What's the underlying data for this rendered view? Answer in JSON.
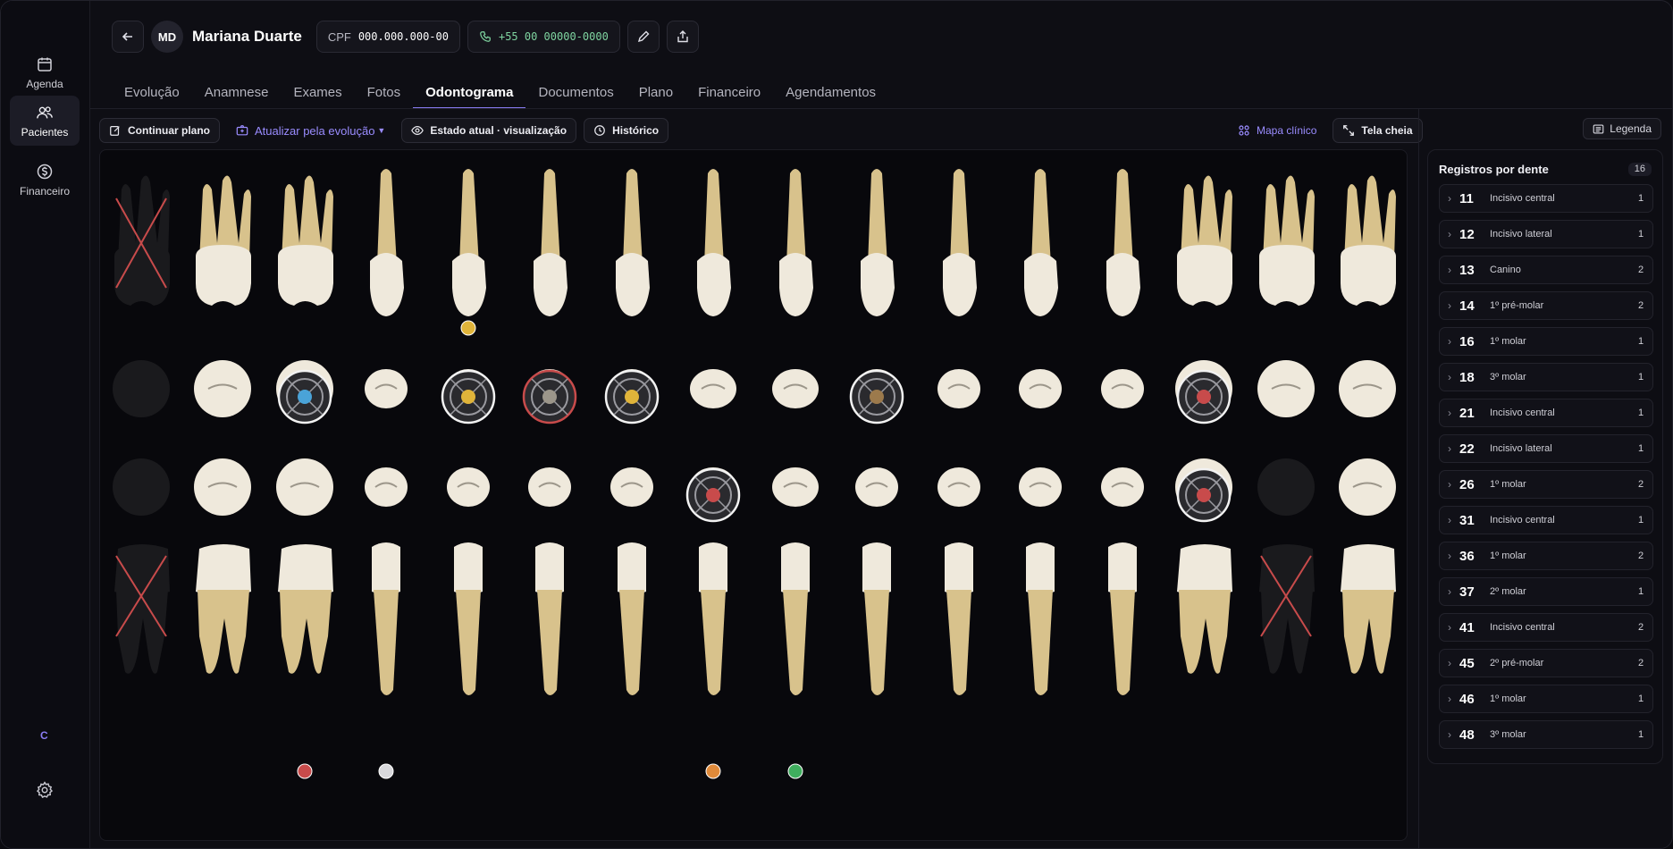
{
  "window": {
    "traffic_colors": [
      "#ff5f57",
      "#febc2e",
      "#28c840"
    ]
  },
  "sidebar": {
    "items": [
      {
        "label": "Agenda",
        "icon": "calendar-icon"
      },
      {
        "label": "Pacientes",
        "icon": "users-icon"
      },
      {
        "label": "Financeiro",
        "icon": "dollar-circle-icon"
      }
    ],
    "user_initial": "C",
    "settings_icon": "gear-icon"
  },
  "header": {
    "initials": "MD",
    "name": "Mariana Duarte",
    "cpf_label": "CPF",
    "cpf_value": "000.000.000-00",
    "phone": "+55 00 00000-0000"
  },
  "tabs": [
    "Evolução",
    "Anamnese",
    "Exames",
    "Fotos",
    "Odontograma",
    "Documentos",
    "Plano",
    "Financeiro",
    "Agendamentos"
  ],
  "active_tab": "Odontograma",
  "toolbar": {
    "continue_plan": "Continuar plano",
    "update_from_evolution": "Atualizar pela evolução",
    "current_state": "Estado atual · visualização",
    "history": "Histórico",
    "clinical_map": "Mapa clínico",
    "fullscreen": "Tela cheia",
    "legend": "Legenda"
  },
  "panel": {
    "title": "Registros por dente",
    "total": "16",
    "records": [
      {
        "tooth": "11",
        "name": "Incisivo central",
        "count": "1"
      },
      {
        "tooth": "12",
        "name": "Incisivo lateral",
        "count": "1"
      },
      {
        "tooth": "13",
        "name": "Canino",
        "count": "2"
      },
      {
        "tooth": "14",
        "name": "1º pré-molar",
        "count": "2"
      },
      {
        "tooth": "16",
        "name": "1º molar",
        "count": "1"
      },
      {
        "tooth": "18",
        "name": "3º molar",
        "count": "1"
      },
      {
        "tooth": "21",
        "name": "Incisivo central",
        "count": "1"
      },
      {
        "tooth": "22",
        "name": "Incisivo lateral",
        "count": "1"
      },
      {
        "tooth": "26",
        "name": "1º molar",
        "count": "2"
      },
      {
        "tooth": "31",
        "name": "Incisivo central",
        "count": "1"
      },
      {
        "tooth": "36",
        "name": "1º molar",
        "count": "2"
      },
      {
        "tooth": "37",
        "name": "2º molar",
        "count": "1"
      },
      {
        "tooth": "41",
        "name": "Incisivo central",
        "count": "2"
      },
      {
        "tooth": "45",
        "name": "2º pré-molar",
        "count": "2"
      },
      {
        "tooth": "46",
        "name": "1º molar",
        "count": "1"
      },
      {
        "tooth": "48",
        "name": "3º molar",
        "count": "1"
      }
    ]
  },
  "odontogram": {
    "upper_row": [
      "18",
      "17",
      "16",
      "15",
      "14",
      "13",
      "12",
      "11",
      "21",
      "22",
      "23",
      "24",
      "25",
      "26",
      "27",
      "28"
    ],
    "lower_row": [
      "48",
      "47",
      "46",
      "45",
      "44",
      "43",
      "42",
      "41",
      "31",
      "32",
      "33",
      "34",
      "35",
      "36",
      "37",
      "38"
    ],
    "missing": [
      "18",
      "48",
      "37"
    ],
    "colors": {
      "tooth": "#efe9dc",
      "root": "#d8c28c",
      "missing": "#1a1a1d",
      "accent": "#8a7cf4",
      "marker_red": "#c84b4b",
      "marker_blue": "#4aa3d8",
      "marker_yellow": "#e0b43a",
      "marker_green": "#3fae5e",
      "marker_orange": "#e08a3a"
    }
  }
}
